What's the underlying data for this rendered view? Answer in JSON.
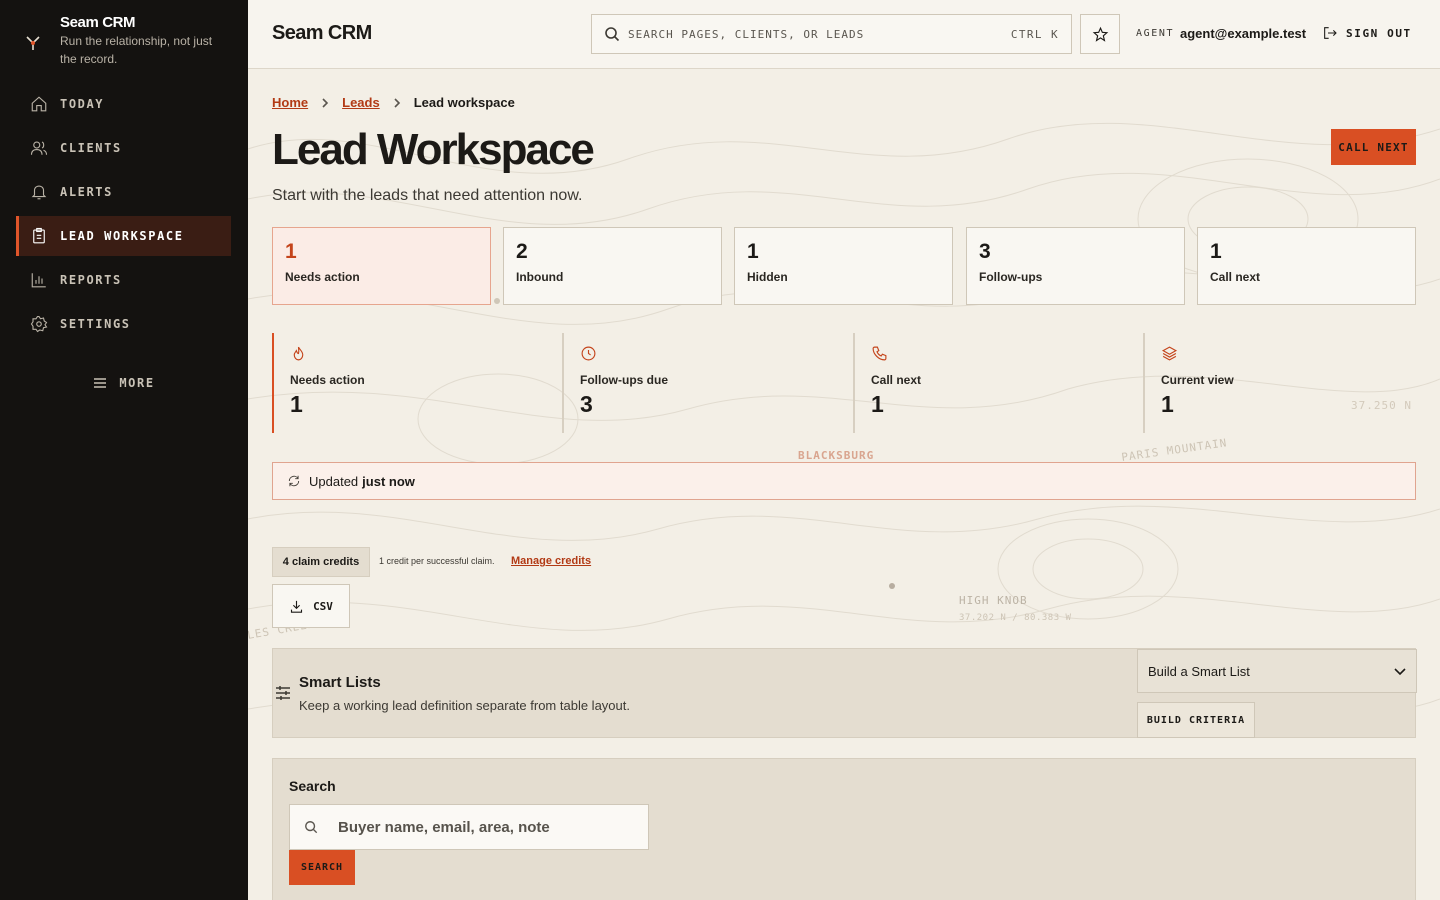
{
  "brand": {
    "name": "Seam CRM",
    "tagline": "Run the relationship, not just the record."
  },
  "nav": {
    "items": [
      {
        "label": "TODAY",
        "icon": "home-icon"
      },
      {
        "label": "CLIENTS",
        "icon": "users-icon"
      },
      {
        "label": "ALERTS",
        "icon": "bell-icon"
      },
      {
        "label": "LEAD WORKSPACE",
        "icon": "clipboard-icon",
        "active": true
      },
      {
        "label": "REPORTS",
        "icon": "bar-chart-icon"
      },
      {
        "label": "SETTINGS",
        "icon": "gear-icon"
      }
    ],
    "more": "MORE"
  },
  "header": {
    "title": "Seam CRM",
    "search_placeholder": "SEARCH PAGES, CLIENTS, OR LEADS",
    "shortcut": "CTRL K",
    "agent_label": "AGENT",
    "agent_email": "agent@example.test",
    "sign_out": "SIGN OUT"
  },
  "breadcrumb": [
    "Home",
    "Leads",
    "Lead workspace"
  ],
  "page": {
    "title": "Lead Workspace",
    "subtitle": "Start with the leads that need attention now.",
    "call_next": "CALL NEXT"
  },
  "tiles": [
    {
      "value": "1",
      "label": "Needs action",
      "active": true
    },
    {
      "value": "2",
      "label": "Inbound"
    },
    {
      "value": "1",
      "label": "Hidden"
    },
    {
      "value": "3",
      "label": "Follow-ups"
    },
    {
      "value": "1",
      "label": "Call next"
    }
  ],
  "stats": [
    {
      "label": "Needs action",
      "value": "1",
      "icon": "flame-icon"
    },
    {
      "label": "Follow-ups due",
      "value": "3",
      "icon": "clock-icon"
    },
    {
      "label": "Call next",
      "value": "1",
      "icon": "phone-icon"
    },
    {
      "label": "Current view",
      "value": "1",
      "icon": "layers-icon"
    }
  ],
  "updated": {
    "prefix": "Updated",
    "value": "just now"
  },
  "credits": {
    "badge": "4 claim credits",
    "note": "1 credit per successful claim.",
    "manage": "Manage credits",
    "csv": "CSV"
  },
  "smart_lists": {
    "title": "Smart Lists",
    "description": "Keep a working lead definition separate from table layout.",
    "select_value": "Build a Smart List",
    "build": "BUILD CRITERIA"
  },
  "lead_search": {
    "label": "Search",
    "placeholder": "Buyer name, email, area, note",
    "button": "SEARCH"
  },
  "map_labels": {
    "blacksburg": "BLACKSBURG",
    "paris_mountain": "PARIS MOUNTAIN",
    "high_knob": "HIGH KNOB",
    "high_knob_coords": "37.202 N / 80.383 W",
    "lat": "37.250 N",
    "creek": "LES CREEK"
  },
  "colors": {
    "accent": "#d94f23",
    "link": "#b23a15",
    "sidebar_bg": "#141210",
    "page_bg": "#f3efe6"
  }
}
